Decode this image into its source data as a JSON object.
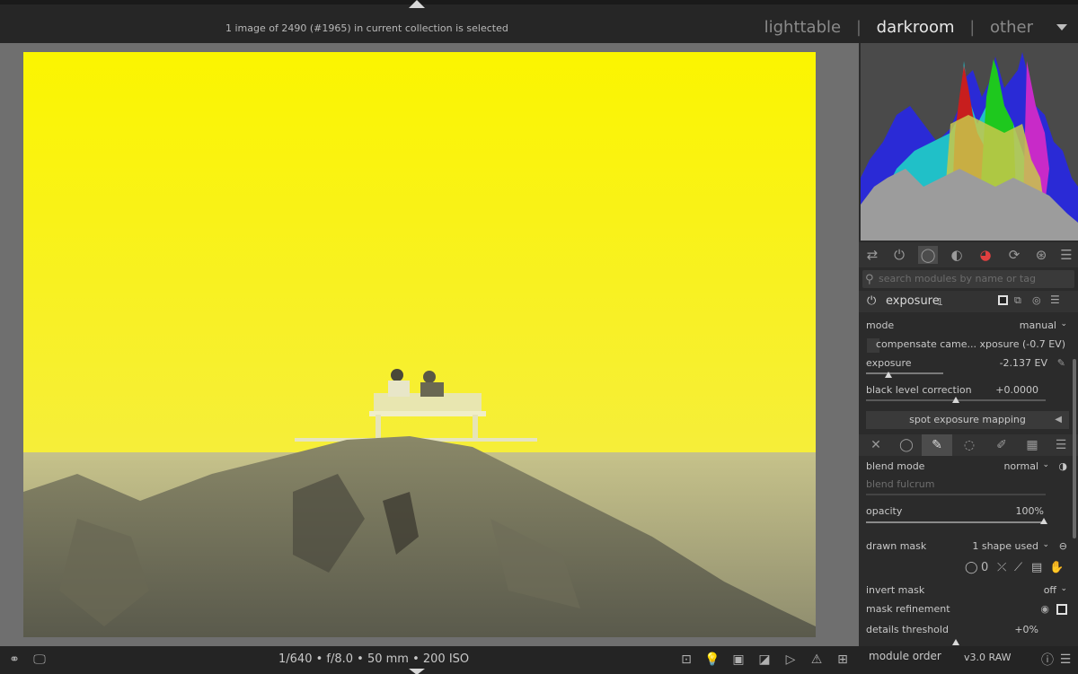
{
  "header": {
    "collection_info": "1 image of 2490 (#1965) in current collection is selected",
    "views": [
      "lighttable",
      "darkroom",
      "other"
    ],
    "active_view": "darkroom",
    "separator": "|"
  },
  "image": {
    "description_colors": {
      "sky": "#fbf500",
      "sea": "#a8a472",
      "rock": "#7a7860"
    }
  },
  "right_panel": {
    "histogram": {
      "colors": {
        "blue": "#2a2ad6",
        "red": "#c81e1e",
        "green": "#1ec81e",
        "cyan": "#20c0c8",
        "magenta": "#c82ac8",
        "yellow": "#c8c84a",
        "gray": "#9c9c9c"
      }
    },
    "module_groups": [
      "quick-access",
      "active-modules",
      "base",
      "tone",
      "color",
      "correct",
      "effect",
      "presets"
    ],
    "search_placeholder": "search modules by name or tag",
    "module": {
      "name": "exposure",
      "instance": "1"
    },
    "params": {
      "mode_label": "mode",
      "mode_value": "manual",
      "compensate_label": "compensate came... xposure (-0.7 EV)",
      "exposure_label": "exposure",
      "exposure_value": "-2.137 EV",
      "black_level_label": "black level correction",
      "black_level_value": "+0.0000",
      "spot_button": "spot exposure mapping"
    },
    "blend": {
      "blend_mode_label": "blend mode",
      "blend_mode_value": "normal",
      "blend_fulcrum_label": "blend fulcrum",
      "opacity_label": "opacity",
      "opacity_value": "100%",
      "drawn_mask_label": "drawn mask",
      "drawn_mask_value": "1 shape used",
      "invert_mask_label": "invert mask",
      "invert_mask_value": "off",
      "mask_refinement_label": "mask refinement",
      "details_threshold_label": "details threshold",
      "details_threshold_value": "+0%"
    }
  },
  "footer": {
    "exif": "1/640 • f/8.0 • 50 mm • 200 ISO",
    "module_order_label": "module order",
    "module_order_value": "v3.0 RAW"
  }
}
